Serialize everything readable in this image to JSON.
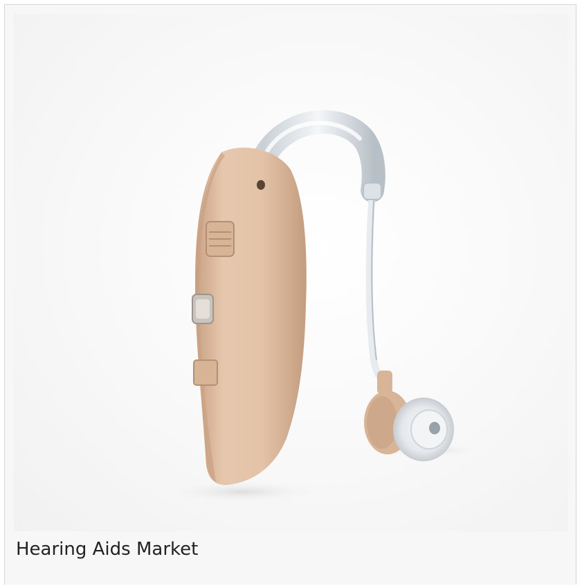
{
  "caption": "Hearing Aids Market",
  "image": {
    "subject": "hearing-aid",
    "colors": {
      "body": "#e2c1a6",
      "body_shadow": "#c9a183",
      "tube": "#dfe4e8",
      "background": "#f7f7f7"
    }
  }
}
